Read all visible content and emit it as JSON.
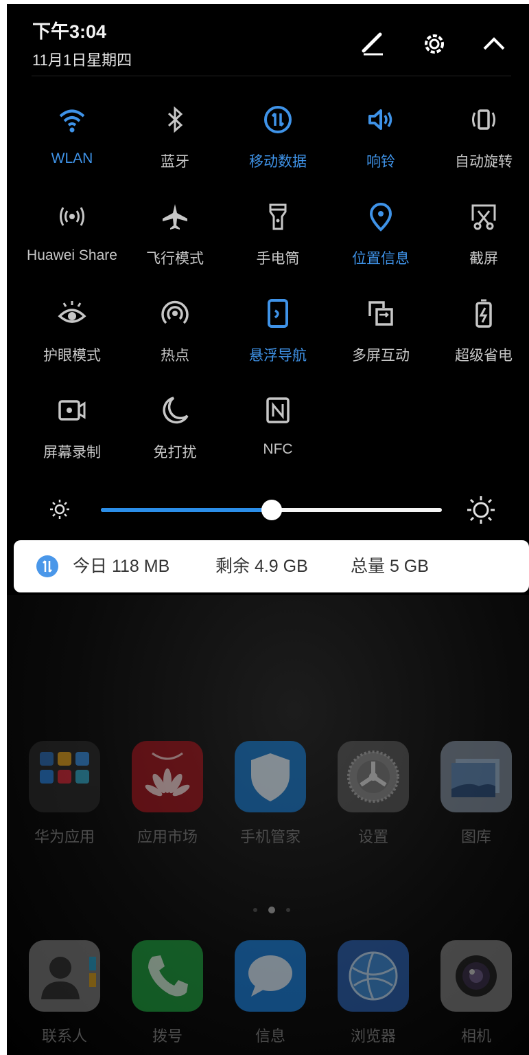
{
  "status": {
    "time": "下午3:04",
    "date": "11月1日星期四"
  },
  "header_icons": [
    "edit-icon",
    "settings-icon",
    "collapse-icon"
  ],
  "toggles": [
    {
      "label": "WLAN",
      "icon": "wifi-icon",
      "on": true
    },
    {
      "label": "蓝牙",
      "icon": "bluetooth-icon",
      "on": false
    },
    {
      "label": "移动数据",
      "icon": "mobile-data-icon",
      "on": true
    },
    {
      "label": "响铃",
      "icon": "ring-icon",
      "on": true
    },
    {
      "label": "自动旋转",
      "icon": "auto-rotate-icon",
      "on": false
    },
    {
      "label": "Huawei Share",
      "icon": "huawei-share-icon",
      "on": false
    },
    {
      "label": "飞行模式",
      "icon": "airplane-icon",
      "on": false
    },
    {
      "label": "手电筒",
      "icon": "flashlight-icon",
      "on": false
    },
    {
      "label": "位置信息",
      "icon": "location-icon",
      "on": true
    },
    {
      "label": "截屏",
      "icon": "screenshot-icon",
      "on": false
    },
    {
      "label": "护眼模式",
      "icon": "eye-comfort-icon",
      "on": false
    },
    {
      "label": "热点",
      "icon": "hotspot-icon",
      "on": false
    },
    {
      "label": "悬浮导航",
      "icon": "floating-dock-icon",
      "on": true
    },
    {
      "label": "多屏互动",
      "icon": "multi-screen-icon",
      "on": false
    },
    {
      "label": "超级省电",
      "icon": "ultra-power-saving-icon",
      "on": false
    },
    {
      "label": "屏幕录制",
      "icon": "screen-record-icon",
      "on": false
    },
    {
      "label": "免打扰",
      "icon": "do-not-disturb-icon",
      "on": false
    },
    {
      "label": "NFC",
      "icon": "nfc-icon",
      "on": false
    }
  ],
  "brightness": {
    "level": 0.5
  },
  "data_usage": {
    "today": "今日 118 MB",
    "remaining": "剩余 4.9 GB",
    "total": "总量 5 GB"
  },
  "home_apps": [
    {
      "name": "华为应用",
      "icon": "huawei-apps-folder-icon",
      "color": "#2a2a2a"
    },
    {
      "name": "应用市场",
      "icon": "app-gallery-icon",
      "color": "#a0141c"
    },
    {
      "name": "手机管家",
      "icon": "phone-manager-icon",
      "color": "#1677c9"
    },
    {
      "name": "设置",
      "icon": "settings-app-icon",
      "color": "#555555"
    },
    {
      "name": "图库",
      "icon": "gallery-icon",
      "color": "#7d8a99"
    }
  ],
  "dock_apps": [
    {
      "name": "联系人",
      "icon": "contacts-icon",
      "color": "#7a7a7a"
    },
    {
      "name": "拨号",
      "icon": "dialer-icon",
      "color": "#1e9e3e"
    },
    {
      "name": "信息",
      "icon": "messages-icon",
      "color": "#1b7fd9"
    },
    {
      "name": "浏览器",
      "icon": "browser-icon",
      "color": "#2a5fae"
    },
    {
      "name": "相机",
      "icon": "camera-icon",
      "color": "#7c7c7c"
    }
  ],
  "colors": {
    "accent": "#3f93e8",
    "inactive": "#c7c7c7",
    "panel": "#000000"
  }
}
